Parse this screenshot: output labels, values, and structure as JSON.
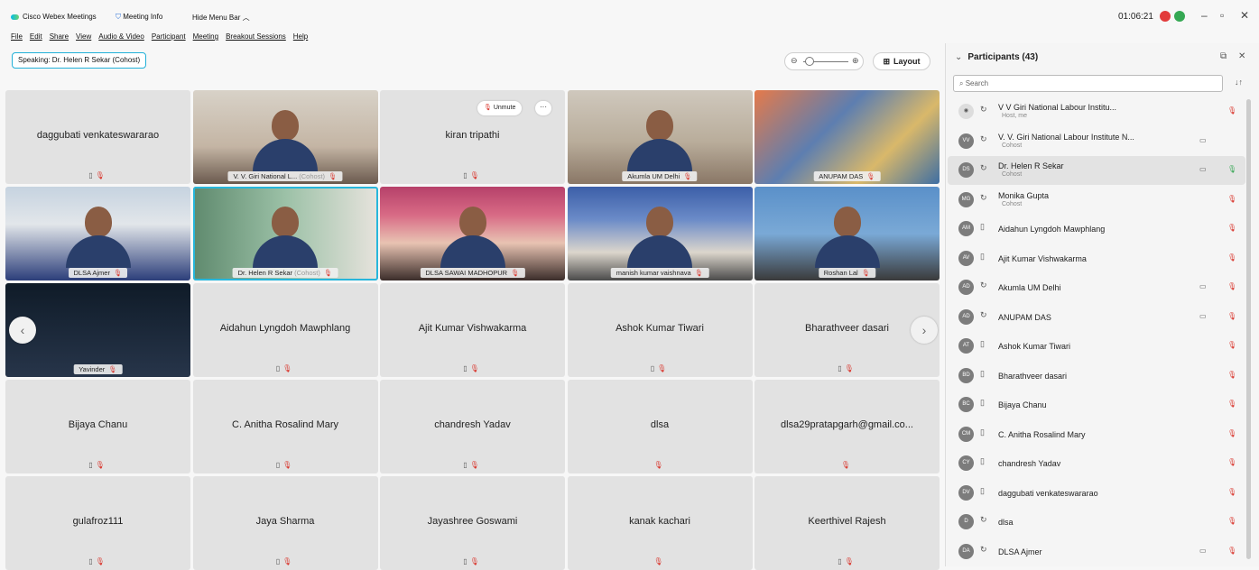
{
  "app": {
    "name": "Cisco Webex Meetings",
    "meeting_info": "Meeting Info",
    "hide_menu": "Hide Menu Bar"
  },
  "menu": [
    "File",
    "Edit",
    "Share",
    "View",
    "Audio & Video",
    "Participant",
    "Meeting",
    "Breakout Sessions",
    "Help"
  ],
  "clock": "01:06:21",
  "window": {
    "minimize": "–",
    "maximize": "▫",
    "close": "✕"
  },
  "speaking": "Speaking: Dr. Helen R Sekar (Cohost)",
  "layout_label": "Layout",
  "unmute_label": "Unmute",
  "video_grid": [
    {
      "name": "daggubati venkateswararao",
      "video": false
    },
    {
      "name": "V. V. Giri National L...",
      "tag": "(Cohost)",
      "video": true
    },
    {
      "name": "kiran tripathi",
      "video": false
    },
    {
      "name": "Akumla UM Delhi",
      "video": true
    },
    {
      "name": "ANUPAM DAS",
      "video": true
    },
    {
      "name": "DLSA Ajmer",
      "video": true
    },
    {
      "name": "Dr. Helen R Sekar",
      "tag": "(Cohost)",
      "video": true
    },
    {
      "name": "DLSA SAWAI MADHOPUR",
      "video": true
    },
    {
      "name": "manish kumar vaishnava",
      "video": true
    },
    {
      "name": "Roshan Lal",
      "video": true
    },
    {
      "name": "Yavinder",
      "video": true
    },
    {
      "name": "Aidahun Lyngdoh Mawphlang",
      "video": false
    },
    {
      "name": "Ajit Kumar Vishwakarma",
      "video": false
    },
    {
      "name": "Ashok Kumar Tiwari",
      "video": false
    },
    {
      "name": "Bharathveer dasari",
      "video": false
    },
    {
      "name": "Bijaya Chanu",
      "video": false
    },
    {
      "name": "C. Anitha Rosalind Mary",
      "video": false
    },
    {
      "name": "chandresh Yadav",
      "video": false
    },
    {
      "name": "dlsa",
      "video": false
    },
    {
      "name": "dlsa29pratapgarh@gmail.co...",
      "video": false
    },
    {
      "name": "gulafroz111",
      "video": false
    },
    {
      "name": "Jaya Sharma",
      "video": false
    },
    {
      "name": "Jayashree Goswami",
      "video": false
    },
    {
      "name": "kanak kachari",
      "video": false
    },
    {
      "name": "Keerthivel Rajesh",
      "video": false
    }
  ],
  "participants_panel": {
    "title": "Participants (43)",
    "search_placeholder": "Search",
    "list": [
      {
        "initials": "",
        "name": "V V Giri National Labour Institu...",
        "role": "Host, me",
        "mic": "muted"
      },
      {
        "initials": "VV",
        "name": "V. V. Giri National Labour Institute N...",
        "role": "Cohost",
        "video": true,
        "mic": "none"
      },
      {
        "initials": "DS",
        "name": "Dr. Helen R Sekar",
        "role": "Cohost",
        "video": true,
        "mic": "on"
      },
      {
        "initials": "MG",
        "name": "Monika Gupta",
        "role": "Cohost",
        "mic": "muted"
      },
      {
        "initials": "AM",
        "name": "Aidahun Lyngdoh Mawphlang",
        "mic": "muted"
      },
      {
        "initials": "AV",
        "name": "Ajit Kumar Vishwakarma",
        "mic": "muted"
      },
      {
        "initials": "AD",
        "name": "Akumla UM Delhi",
        "video": true,
        "mic": "muted"
      },
      {
        "initials": "AD",
        "name": "ANUPAM DAS",
        "video": true,
        "mic": "muted"
      },
      {
        "initials": "AT",
        "name": "Ashok Kumar Tiwari",
        "mic": "muted"
      },
      {
        "initials": "BD",
        "name": "Bharathveer dasari",
        "mic": "muted"
      },
      {
        "initials": "BC",
        "name": "Bijaya Chanu",
        "mic": "muted"
      },
      {
        "initials": "CM",
        "name": "C. Anitha Rosalind Mary",
        "mic": "muted"
      },
      {
        "initials": "CY",
        "name": "chandresh Yadav",
        "mic": "muted"
      },
      {
        "initials": "DV",
        "name": "daggubati venkateswararao",
        "mic": "muted"
      },
      {
        "initials": "D",
        "name": "dlsa",
        "mic": "muted"
      },
      {
        "initials": "DA",
        "name": "DLSA Ajmer",
        "video": true,
        "mic": "muted"
      }
    ]
  },
  "colors": {
    "accent": "#27b6db",
    "muted_mic": "#d9342b",
    "active_mic": "#3aa757"
  }
}
